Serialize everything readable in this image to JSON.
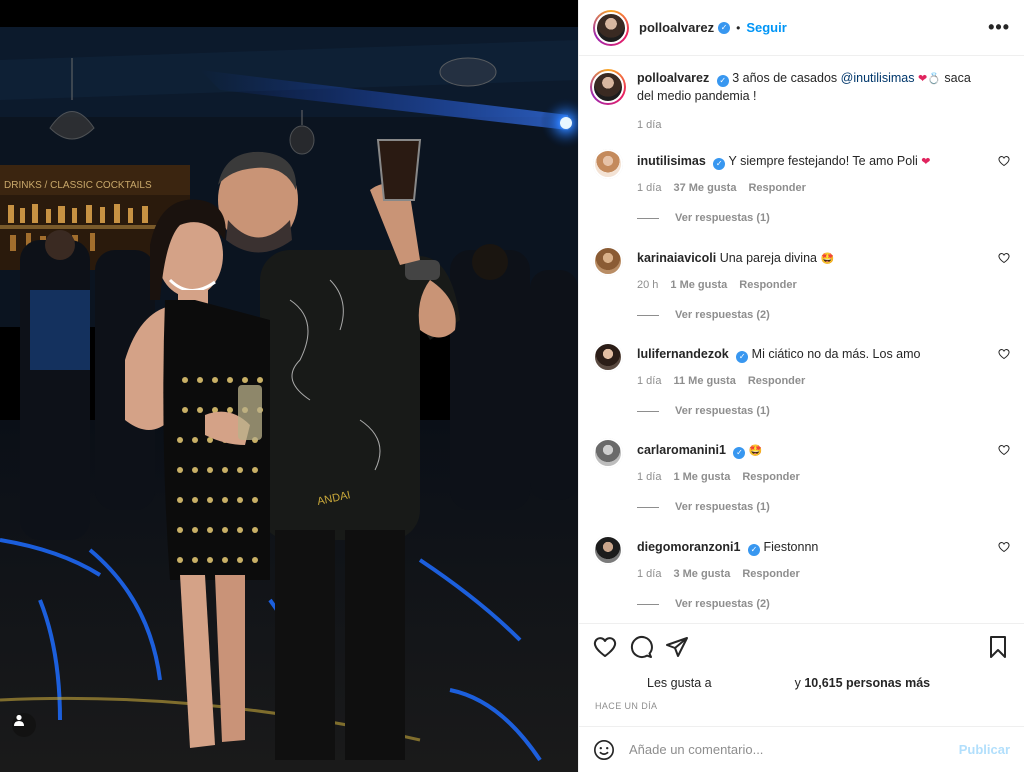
{
  "post": {
    "username": "polloalvarez",
    "follow_label": "Seguir",
    "more_label": "•••",
    "caption": {
      "username": "polloalvarez",
      "text_before": "3 años de casados",
      "mention": "@inutilisimas",
      "text_after": "saca del medio pandemia !",
      "time": "1 día"
    }
  },
  "comments": [
    {
      "username": "inutilisimas",
      "verified": true,
      "text": "Y siempre festejando! Te amo Poli",
      "emoji": "❤",
      "time": "1 día",
      "likes": "37 Me gusta",
      "reply": "Responder",
      "replies": "Ver respuestas (1)"
    },
    {
      "username": "karinaiavicoli",
      "verified": false,
      "text": "Una pareja divina",
      "emoji": "🤩",
      "time": "20 h",
      "likes": "1 Me gusta",
      "reply": "Responder",
      "replies": "Ver respuestas (2)"
    },
    {
      "username": "lulifernandezok",
      "verified": true,
      "text": "Mi ciático no da más. Los amo",
      "emoji": "",
      "time": "1 día",
      "likes": "11 Me gusta",
      "reply": "Responder",
      "replies": "Ver respuestas (1)"
    },
    {
      "username": "carlaromanini1",
      "verified": true,
      "text": "",
      "emoji": "🤩",
      "time": "1 día",
      "likes": "1 Me gusta",
      "reply": "Responder",
      "replies": "Ver respuestas (1)"
    },
    {
      "username": "diegomoranzoni1",
      "verified": true,
      "text": "Fiestonnn",
      "emoji": "",
      "time": "1 día",
      "likes": "3 Me gusta",
      "reply": "Responder",
      "replies": "Ver respuestas (2)"
    }
  ],
  "likes": {
    "prefix": "Les gusta a",
    "suffix": "y",
    "count": "10,615 personas más"
  },
  "posted_ago": "HACE UN DÍA",
  "add_comment": {
    "placeholder": "Añade un comentario...",
    "publish_label": "Publicar"
  },
  "photo": {
    "sign_text": "DRINKS / CLASSIC COCKTAILS"
  },
  "colors": {
    "link_blue": "#0095f6",
    "publish_disabled": "#b2dffc",
    "verified": "#3897f0",
    "meta_gray": "#8e8e8e"
  },
  "icons": [
    "more-icon",
    "verified-icon",
    "heart-icon",
    "comment-icon",
    "share-icon",
    "save-icon",
    "emoji-icon",
    "tag-user-icon"
  ]
}
